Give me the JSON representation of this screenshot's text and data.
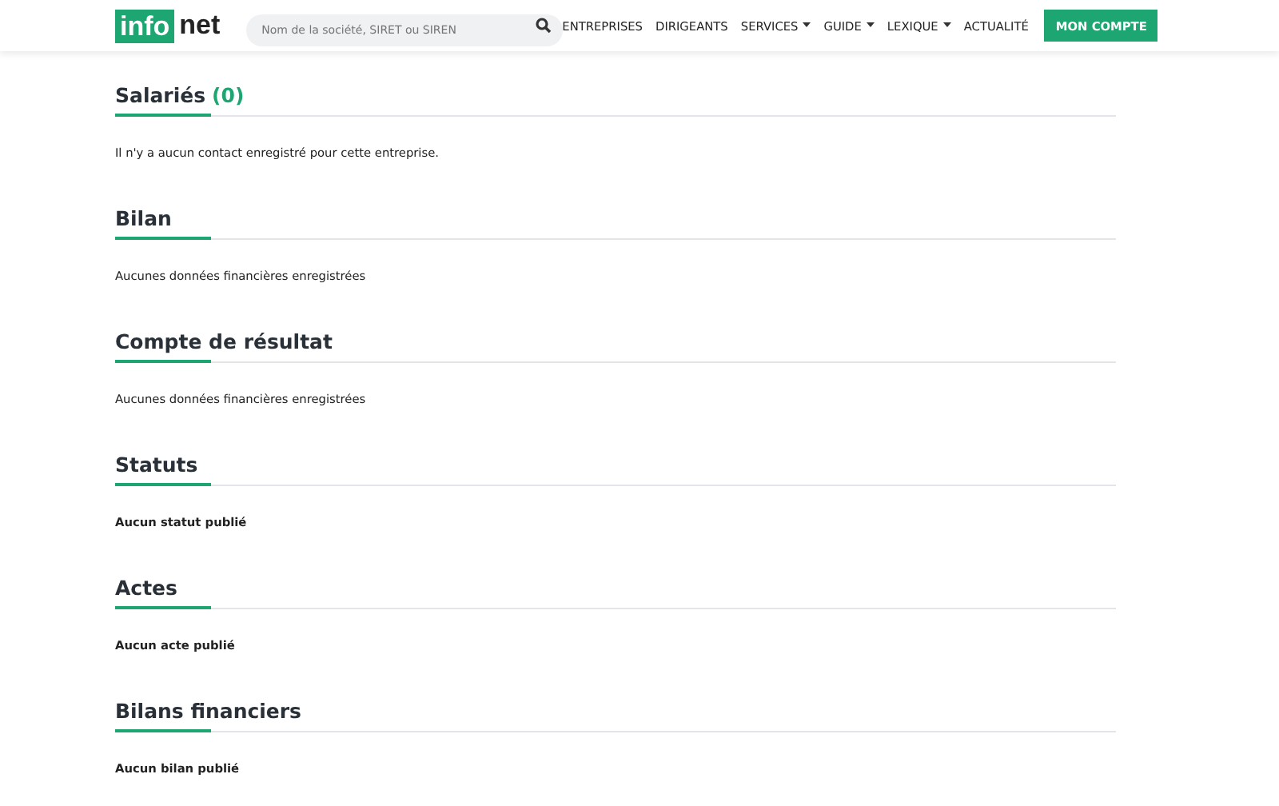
{
  "logo": {
    "left": "info",
    "right": "net"
  },
  "search": {
    "placeholder": "Nom de la société, SIRET ou SIREN"
  },
  "nav": [
    {
      "label": "ENTREPRISES",
      "has_menu": false
    },
    {
      "label": "DIRIGEANTS",
      "has_menu": false
    },
    {
      "label": "SERVICES",
      "has_menu": true
    },
    {
      "label": "GUIDE",
      "has_menu": true
    },
    {
      "label": "LEXIQUE",
      "has_menu": true
    },
    {
      "label": "ACTUALITÉ",
      "has_menu": false
    }
  ],
  "account_button": "MON COMPTE",
  "sections": [
    {
      "title": "Salariés",
      "count": "(0)",
      "text": "Il n'y a aucun contact enregistré pour cette entreprise.",
      "bold": false
    },
    {
      "title": "Bilan",
      "text": "Aucunes données financières enregistrées",
      "bold": false
    },
    {
      "title": "Compte de résultat",
      "text": "Aucunes données financières enregistrées",
      "bold": false
    },
    {
      "title": "Statuts",
      "text": "Aucun statut publié",
      "bold": true
    },
    {
      "title": "Actes",
      "text": "Aucun acte publié",
      "bold": true
    },
    {
      "title": "Bilans financiers",
      "text": "Aucun bilan publié",
      "bold": true
    }
  ]
}
